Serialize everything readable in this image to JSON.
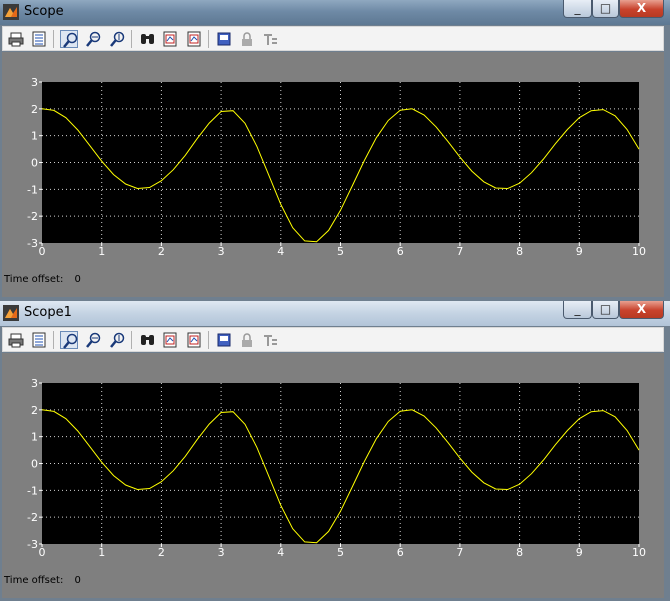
{
  "windows": [
    {
      "title": "Scope",
      "controls": {
        "minimize": "_",
        "maximize": "□",
        "close": "X"
      },
      "time_offset_label": "Time offset:",
      "time_offset_value": "0",
      "chart_data": {
        "type": "line",
        "title": "",
        "xlabel": "",
        "ylabel": "",
        "xlim": [
          0,
          10
        ],
        "ylim": [
          -3,
          3
        ],
        "xticks": [
          "0",
          "1",
          "2",
          "3",
          "4",
          "5",
          "6",
          "7",
          "8",
          "9",
          "10"
        ],
        "yticks": [
          "3",
          "2",
          "1",
          "0",
          "-1",
          "-2",
          "-3"
        ],
        "grid": true,
        "background": "#000000",
        "series": [
          {
            "color": "#ffff00",
            "x": [
              0,
              0.2,
              0.4,
              0.6,
              0.8,
              1,
              1.2,
              1.4,
              1.6,
              1.8,
              2,
              2.2,
              2.4,
              2.6,
              2.8,
              3,
              3.2,
              3.4,
              3.6,
              3.8,
              4,
              4.2,
              4.4,
              4.6,
              4.8,
              5,
              5.2,
              5.4,
              5.6,
              5.8,
              6,
              6.2,
              6.4,
              6.6,
              6.8,
              7,
              7.2,
              7.4,
              7.6,
              7.8,
              8,
              8.2,
              8.4,
              8.6,
              8.8,
              9,
              9.2,
              9.4,
              9.6,
              9.8,
              10
            ],
            "y": [
              2.0,
              1.94,
              1.67,
              1.21,
              0.63,
              0.05,
              -0.45,
              -0.8,
              -0.97,
              -0.93,
              -0.68,
              -0.27,
              0.27,
              0.89,
              1.47,
              1.9,
              1.93,
              1.46,
              0.6,
              -0.48,
              -1.56,
              -2.43,
              -2.92,
              -2.95,
              -2.53,
              -1.78,
              -0.86,
              0.08,
              0.92,
              1.57,
              1.95,
              2.0,
              1.77,
              1.33,
              0.78,
              0.2,
              -0.32,
              -0.72,
              -0.95,
              -0.97,
              -0.77,
              -0.38,
              0.13,
              0.7,
              1.23,
              1.67,
              1.93,
              1.97,
              1.74,
              1.23,
              0.5
            ]
          }
        ]
      }
    },
    {
      "title": "Scope1",
      "controls": {
        "minimize": "_",
        "maximize": "□",
        "close": "X"
      },
      "time_offset_label": "Time offset:",
      "time_offset_value": "0",
      "chart_data": {
        "type": "line",
        "title": "",
        "xlabel": "",
        "ylabel": "",
        "xlim": [
          0,
          10
        ],
        "ylim": [
          -3,
          3
        ],
        "xticks": [
          "0",
          "1",
          "2",
          "3",
          "4",
          "5",
          "6",
          "7",
          "8",
          "9",
          "10"
        ],
        "yticks": [
          "3",
          "2",
          "1",
          "0",
          "-1",
          "-2",
          "-3"
        ],
        "grid": true,
        "background": "#000000",
        "series": [
          {
            "color": "#ffff00",
            "x": [
              0,
              0.2,
              0.4,
              0.6,
              0.8,
              1,
              1.2,
              1.4,
              1.6,
              1.8,
              2,
              2.2,
              2.4,
              2.6,
              2.8,
              3,
              3.2,
              3.4,
              3.6,
              3.8,
              4,
              4.2,
              4.4,
              4.6,
              4.8,
              5,
              5.2,
              5.4,
              5.6,
              5.8,
              6,
              6.2,
              6.4,
              6.6,
              6.8,
              7,
              7.2,
              7.4,
              7.6,
              7.8,
              8,
              8.2,
              8.4,
              8.6,
              8.8,
              9,
              9.2,
              9.4,
              9.6,
              9.8,
              10
            ],
            "y": [
              2.0,
              1.94,
              1.67,
              1.21,
              0.63,
              0.05,
              -0.45,
              -0.8,
              -0.97,
              -0.93,
              -0.68,
              -0.27,
              0.27,
              0.89,
              1.47,
              1.9,
              1.93,
              1.46,
              0.6,
              -0.48,
              -1.56,
              -2.43,
              -2.92,
              -2.95,
              -2.53,
              -1.78,
              -0.86,
              0.08,
              0.92,
              1.57,
              1.95,
              2.0,
              1.77,
              1.33,
              0.78,
              0.2,
              -0.32,
              -0.72,
              -0.95,
              -0.97,
              -0.77,
              -0.38,
              0.13,
              0.7,
              1.23,
              1.67,
              1.93,
              1.97,
              1.74,
              1.23,
              0.5
            ]
          }
        ]
      }
    }
  ],
  "toolbar_icons": [
    "print-icon",
    "parameters-icon",
    "zoom-icon",
    "zoom-x-icon",
    "zoom-y-icon",
    "autoscale-icon",
    "save-axes-icon",
    "restore-axes-icon",
    "floating-scope-icon",
    "lock-icon",
    "signal-selection-icon"
  ]
}
